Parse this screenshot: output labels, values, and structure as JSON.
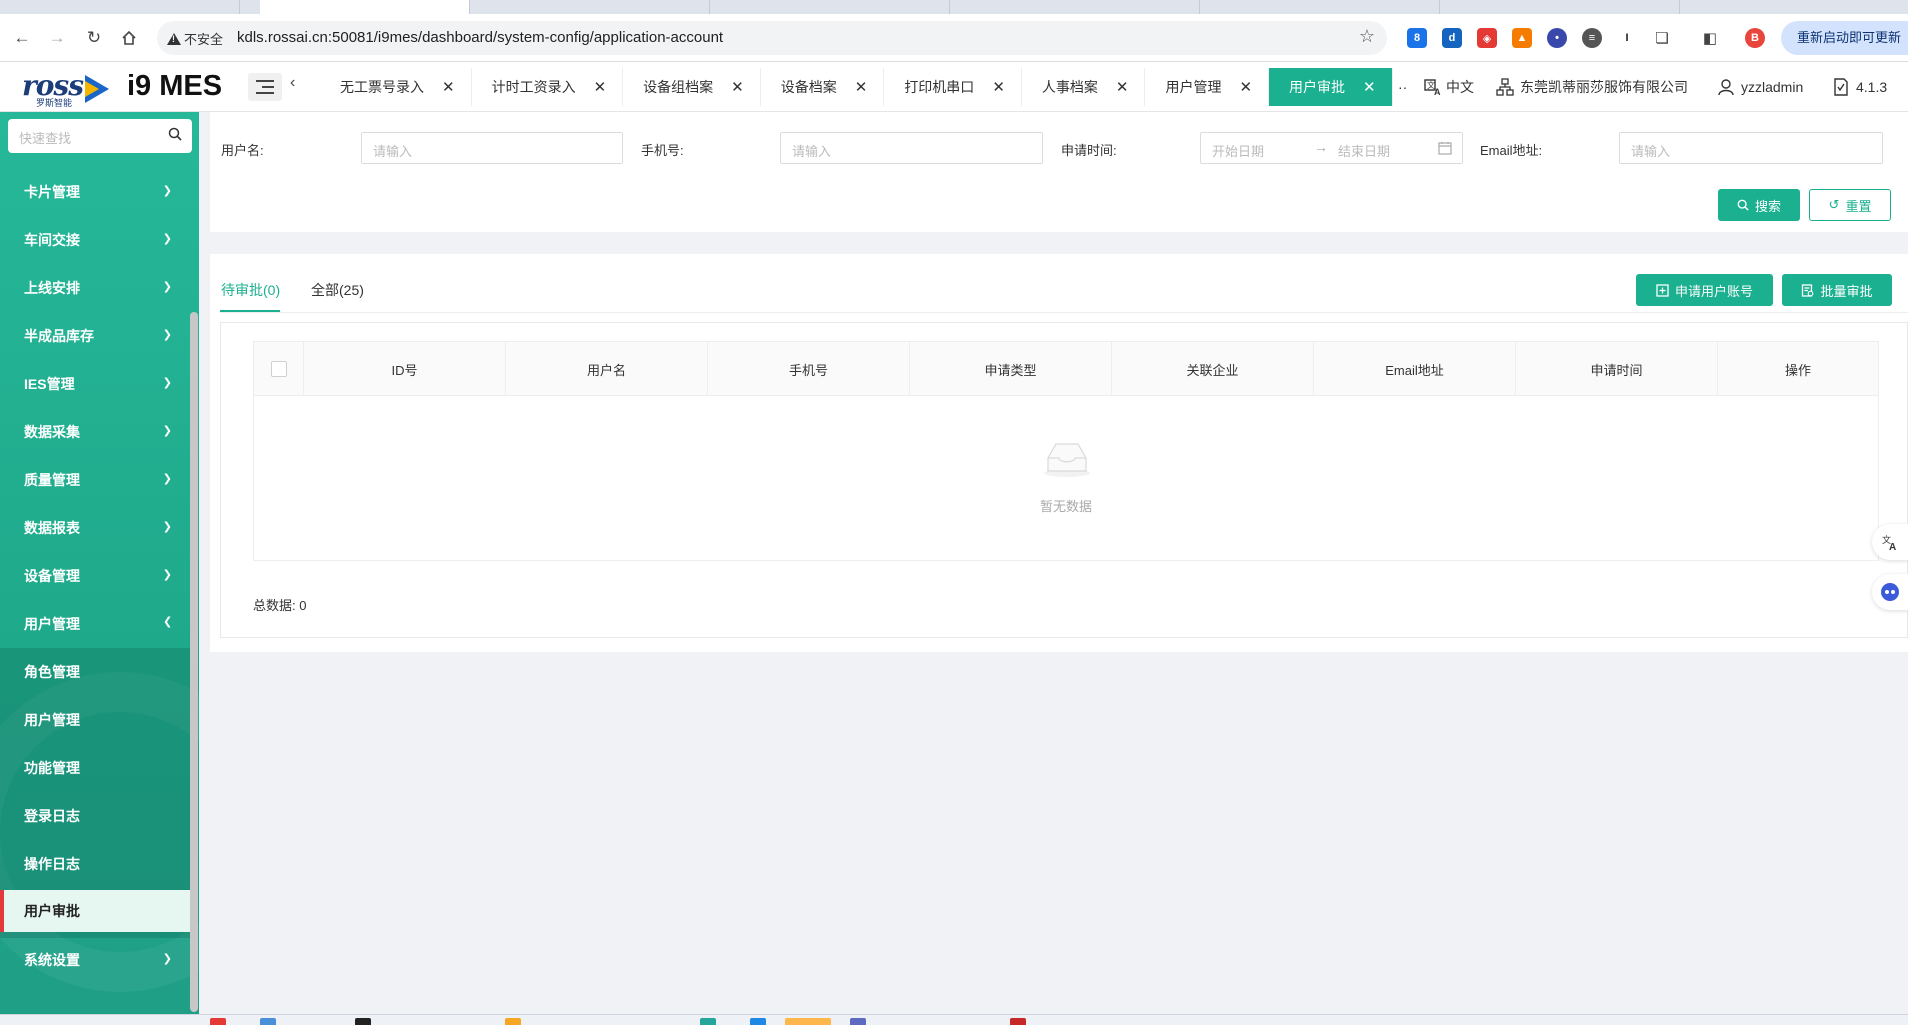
{
  "browser": {
    "security_label": "不安全",
    "url": "kdls.rossai.cn:50081/i9mes/dashboard/system-config/application-account",
    "update_label": "重新启动即可更新",
    "profile_letter": "B"
  },
  "header": {
    "logo_text": "ross",
    "logo_subtext": "罗斯智能",
    "brand": "i9 MES",
    "tabs": [
      {
        "label": "无工票号录入"
      },
      {
        "label": "计时工资录入"
      },
      {
        "label": "设备组档案"
      },
      {
        "label": "设备档案"
      },
      {
        "label": "打印机串口"
      },
      {
        "label": "人事档案"
      },
      {
        "label": "用户管理"
      },
      {
        "label": "用户审批"
      }
    ],
    "more": "··",
    "language": "中文",
    "company": "东莞凯蒂丽莎服饰有限公司",
    "user": "yzzladmin",
    "version": "4.1.3"
  },
  "sidebar": {
    "search_placeholder": "快速查找",
    "items": [
      {
        "label": "卡片管理"
      },
      {
        "label": "车间交接"
      },
      {
        "label": "上线安排"
      },
      {
        "label": "半成品库存"
      },
      {
        "label": "IES管理"
      },
      {
        "label": "数据采集"
      },
      {
        "label": "质量管理"
      },
      {
        "label": "数据报表"
      },
      {
        "label": "设备管理"
      },
      {
        "label": "用户管理"
      }
    ],
    "subitems": [
      {
        "label": "角色管理"
      },
      {
        "label": "用户管理"
      },
      {
        "label": "功能管理"
      },
      {
        "label": "登录日志"
      },
      {
        "label": "操作日志"
      },
      {
        "label": "用户审批"
      }
    ],
    "last_item": {
      "label": "系统设置"
    }
  },
  "filters": {
    "username_label": "用户名:",
    "username_placeholder": "请输入",
    "phone_label": "手机号:",
    "phone_placeholder": "请输入",
    "time_label": "申请时间:",
    "start_placeholder": "开始日期",
    "end_placeholder": "结束日期",
    "email_label": "Email地址:",
    "email_placeholder": "请输入",
    "search_button": "搜索",
    "reset_button": "重置"
  },
  "content": {
    "tab_pending": "待审批(0)",
    "tab_all": "全部(25)",
    "apply_button": "申请用户账号",
    "batch_button": "批量审批",
    "columns": [
      "ID号",
      "用户名",
      "手机号",
      "申请类型",
      "关联企业",
      "Email地址",
      "申请时间",
      "操作"
    ],
    "empty_text": "暂无数据",
    "total_label": "总数据: 0"
  },
  "colors": {
    "accent": "#1bb08f",
    "sidebar": "#22b295",
    "selected_marker": "#e4393c"
  }
}
